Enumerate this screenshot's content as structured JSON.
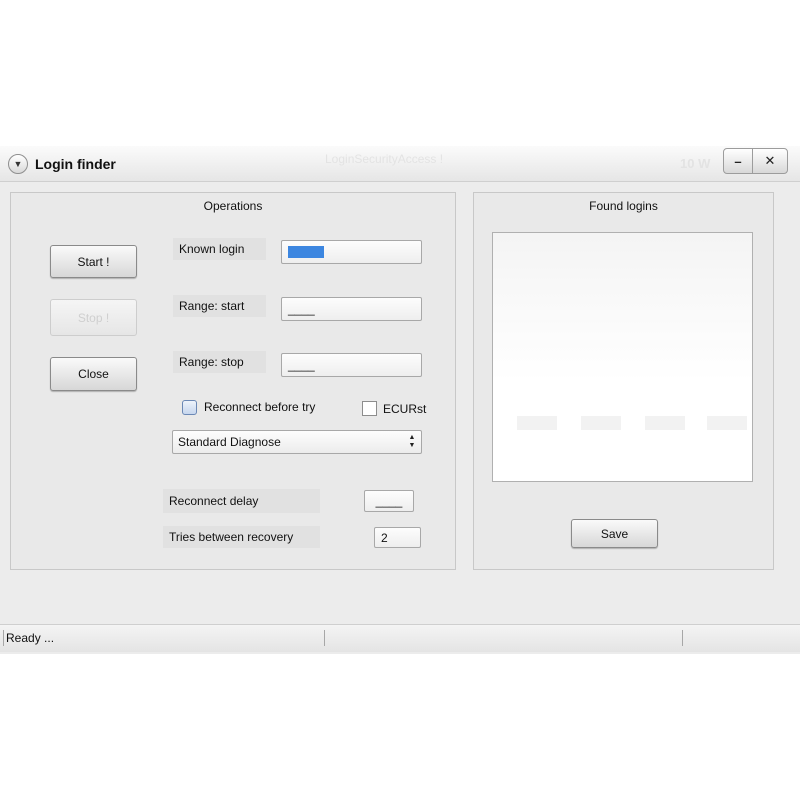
{
  "window": {
    "title": "Login finder",
    "ghost_title": "LoginSecurityAccess !",
    "ghost_right": "10 W",
    "minimize_label": "–",
    "close_label": "✕"
  },
  "operations": {
    "title": "Operations",
    "start_label": "Start !",
    "stop_label": "Stop !",
    "close_label": "Close",
    "known_login_label": "Known login",
    "range_start_label": "Range: start",
    "range_start_value": "____",
    "range_stop_label": "Range: stop",
    "range_stop_value": "____",
    "reconnect_label": "Reconnect before try",
    "reconnect_checked": false,
    "ecurst_label": "ECURst",
    "ecurst_checked": false,
    "diagnose_selected": "Standard Diagnose",
    "reconnect_delay_label": "Reconnect delay",
    "reconnect_delay_value": "____",
    "tries_label": "Tries between recovery",
    "tries_value": "2"
  },
  "found": {
    "title": "Found logins",
    "save_label": "Save"
  },
  "status": {
    "text": "Ready ..."
  },
  "icons": {
    "menu": "chevron-down-icon",
    "combo": "updown-arrows-icon"
  },
  "colors": {
    "selection": "#3c86e0",
    "window_bg": "#ececec"
  }
}
